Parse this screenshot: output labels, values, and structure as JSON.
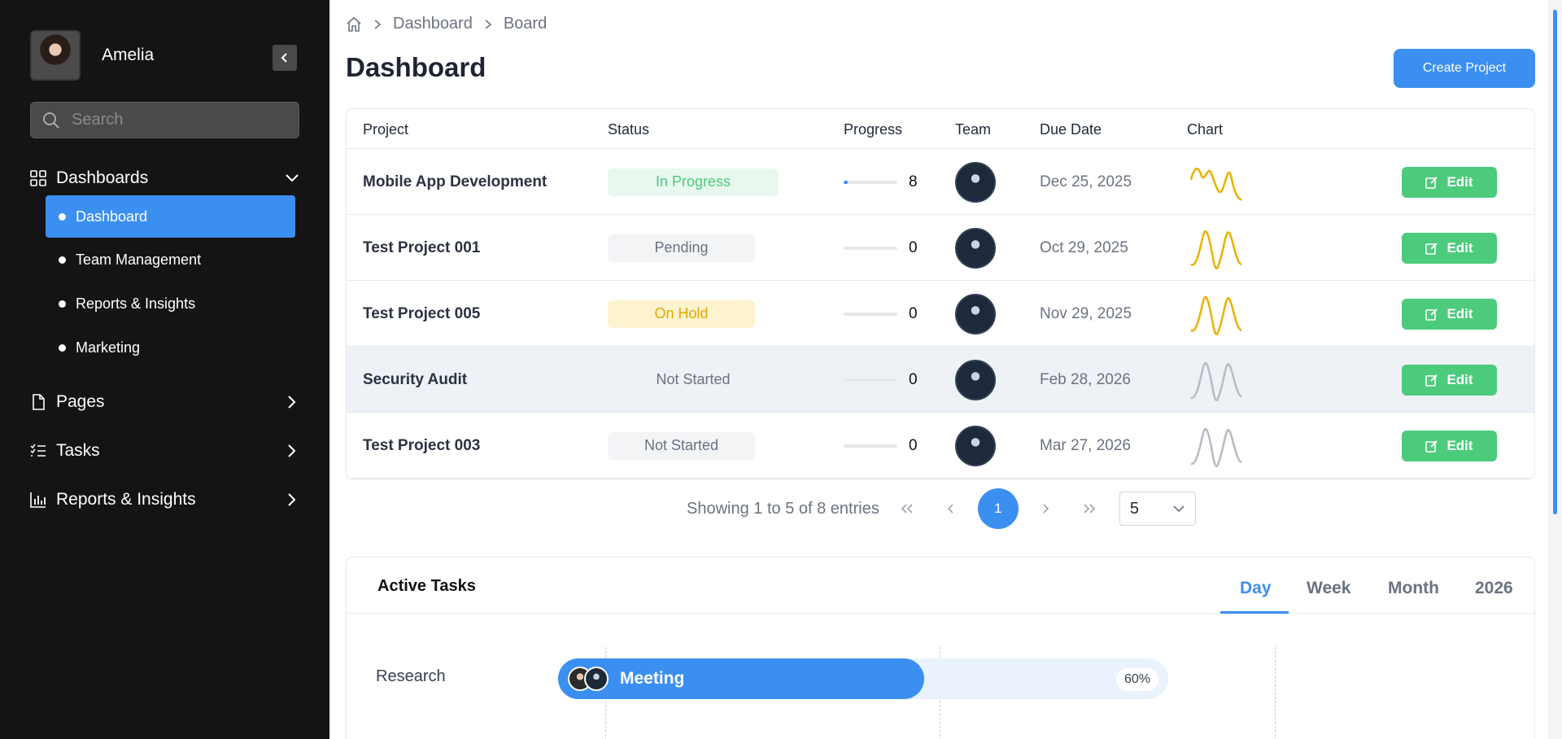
{
  "sidebar": {
    "user_name": "Amelia",
    "search_placeholder": "Search",
    "groups": [
      {
        "label": "Dashboards",
        "icon": "grid-icon",
        "expanded": true
      },
      {
        "label": "Pages",
        "icon": "file-icon",
        "expanded": false
      },
      {
        "label": "Tasks",
        "icon": "list-check-icon",
        "expanded": false
      },
      {
        "label": "Reports & Insights",
        "icon": "bar-chart-icon",
        "expanded": false
      }
    ],
    "dashboard_items": [
      {
        "label": "Dashboard",
        "active": true
      },
      {
        "label": "Team Management",
        "active": false
      },
      {
        "label": "Reports & Insights",
        "active": false
      },
      {
        "label": "Marketing",
        "active": false
      }
    ]
  },
  "breadcrumb": [
    "Dashboard",
    "Board"
  ],
  "page_title": "Dashboard",
  "create_button": "Create Project",
  "table": {
    "headers": [
      "Project",
      "Status",
      "Progress",
      "Team",
      "Due Date",
      "Chart"
    ],
    "edit_label": "Edit",
    "rows": [
      {
        "project": "Mobile App Development",
        "status": "In Progress",
        "status_style": "green",
        "progress": 8,
        "due": "Dec 25, 2025",
        "chart_color": "#eab308",
        "highlighted": false
      },
      {
        "project": "Test Project 001",
        "status": "Pending",
        "status_style": "gray",
        "progress": 0,
        "due": "Oct 29, 2025",
        "chart_color": "#eab308",
        "highlighted": false
      },
      {
        "project": "Test Project 005",
        "status": "On Hold",
        "status_style": "yellow",
        "progress": 0,
        "due": "Nov 29, 2025",
        "chart_color": "#eab308",
        "highlighted": false
      },
      {
        "project": "Security Audit",
        "status": "Not Started",
        "status_style": "plain",
        "progress": 0,
        "due": "Feb 28, 2026",
        "chart_color": "#b8bcc4",
        "highlighted": true
      },
      {
        "project": "Test Project 003",
        "status": "Not Started",
        "status_style": "gray",
        "progress": 0,
        "due": "Mar 27, 2026",
        "chart_color": "#b8bcc4",
        "highlighted": false
      }
    ]
  },
  "pagination": {
    "summary": "Showing 1 to 5 of 8 entries",
    "current_page": "1",
    "page_size": "5"
  },
  "tasks": {
    "title": "Active Tasks",
    "tabs": [
      {
        "label": "Day",
        "active": true
      },
      {
        "label": "Week",
        "active": false
      },
      {
        "label": "Month",
        "active": false
      },
      {
        "label": "2026",
        "active": false
      }
    ],
    "rows": [
      {
        "category": "Research",
        "task": "Meeting",
        "progress_label": "60%",
        "progress": 0.6
      }
    ]
  },
  "colors": {
    "accent": "#3b8ff0",
    "edit_green": "#4ccb7d",
    "sidebar_bg": "#141414"
  }
}
